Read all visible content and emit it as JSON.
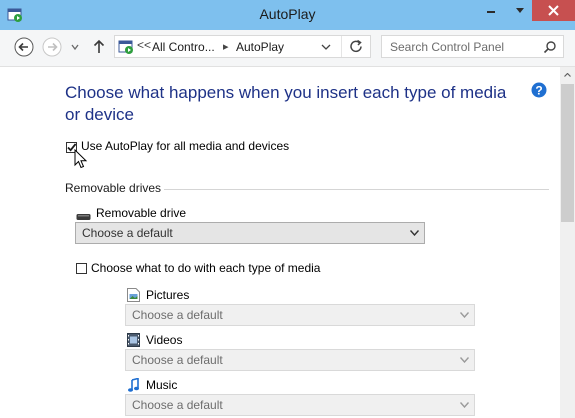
{
  "window": {
    "title": "AutoPlay"
  },
  "navbar": {
    "breadcrumb_prefix": "<<",
    "breadcrumb": [
      "All Contro...",
      "AutoPlay"
    ],
    "search_placeholder": "Search Control Panel"
  },
  "main": {
    "heading": "Choose what happens when you insert each type of media or device",
    "use_autoplay": {
      "label": "Use AutoPlay for all media and devices",
      "checked": true
    },
    "removable_section": "Removable drives",
    "removable_drive": {
      "label": "Removable drive",
      "value": "Choose a default"
    },
    "each_type": {
      "label": "Choose what to do with each type of media",
      "checked": false
    },
    "media": [
      {
        "label": "Pictures",
        "value": "Choose a default",
        "icon": "pictures-icon"
      },
      {
        "label": "Videos",
        "value": "Choose a default",
        "icon": "videos-icon"
      },
      {
        "label": "Music",
        "value": "Choose a default",
        "icon": "music-icon"
      }
    ]
  },
  "colors": {
    "titlebar": "#7ec0ee",
    "close": "#c75050",
    "heading": "#1e3287",
    "help": "#1f6fd1"
  }
}
